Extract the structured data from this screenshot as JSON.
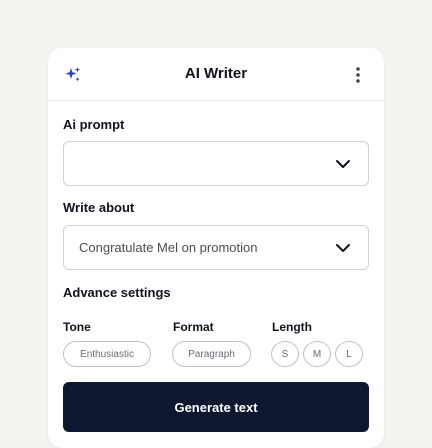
{
  "header": {
    "title": "AI Writer",
    "left_icon": "sparkle-icon",
    "right_icon": "more-vertical-icon"
  },
  "ai_prompt": {
    "label": "Ai prompt",
    "value": ""
  },
  "write_about": {
    "label": "Write about",
    "value": "Congratulate Mel on promotion"
  },
  "advance_settings": {
    "label": "Advance settings",
    "tone": {
      "label": "Tone",
      "value": "Enthusiastic"
    },
    "format": {
      "label": "Format",
      "value": "Paragraph"
    },
    "length": {
      "label": "Length",
      "options": [
        "S",
        "M",
        "L"
      ]
    }
  },
  "generate_button": {
    "label": "Generate text"
  },
  "colors": {
    "background": "#f4f3ee",
    "card": "#ffffff",
    "primary_button": "#0f1730",
    "text": "#10131f",
    "border": "#cfd1d6"
  }
}
